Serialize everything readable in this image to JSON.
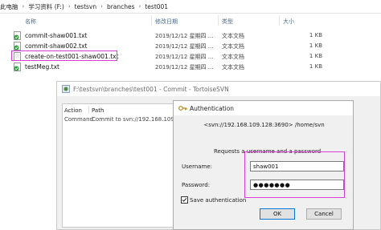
{
  "explorer": {
    "breadcrumb": [
      "此电脑",
      "学习资料 (F:)",
      "testsvn",
      "branches",
      "test001"
    ],
    "columns": {
      "name": "名称",
      "date": "修改日期",
      "type": "类型",
      "size": "大小"
    },
    "files": [
      {
        "name": "commit-shaw001.txt",
        "date": "2019/12/12 星期四 ...",
        "type": "文本文档",
        "size": "1 KB",
        "status": "committed"
      },
      {
        "name": "commit-shaw002.txt",
        "date": "2019/12/12 星期四 ...",
        "type": "文本文档",
        "size": "1 KB",
        "status": "committed"
      },
      {
        "name": "create-on-test001-shaw001.txt",
        "date": "2019/12/12 星期四 ...",
        "type": "文本文档",
        "size": "1 KB",
        "status": "new"
      },
      {
        "name": "testMeg.txt",
        "date": "2019/12/12 星期四 ...",
        "type": "文本文档",
        "size": "1 KB",
        "status": "committed"
      }
    ]
  },
  "commit_window": {
    "title": "F:\\testsvn\\branches\\test001 - Commit - TortoiseSVN",
    "columns": {
      "action": "Action",
      "path": "Path"
    },
    "rows": [
      {
        "action": "Command",
        "path": "Commit to svn://192.168.109.1"
      }
    ]
  },
  "auth_dialog": {
    "title": "Authentication",
    "realm": "<svn://192.168.109.128:3690> /home/svn",
    "prompt": "Requests a username and a password",
    "username_label": "Username:",
    "username_value": "shaw001",
    "password_label": "Password:",
    "password_value": "●●●●●●●",
    "save_auth_label": "Save authentication",
    "save_auth_checked": true,
    "ok_label": "OK",
    "cancel_label": "Cancel"
  },
  "colors": {
    "highlight": "#d63fd6",
    "svn_ok": "#2e9a3a",
    "folder": "#f0c040",
    "accent": "#0078d7"
  }
}
